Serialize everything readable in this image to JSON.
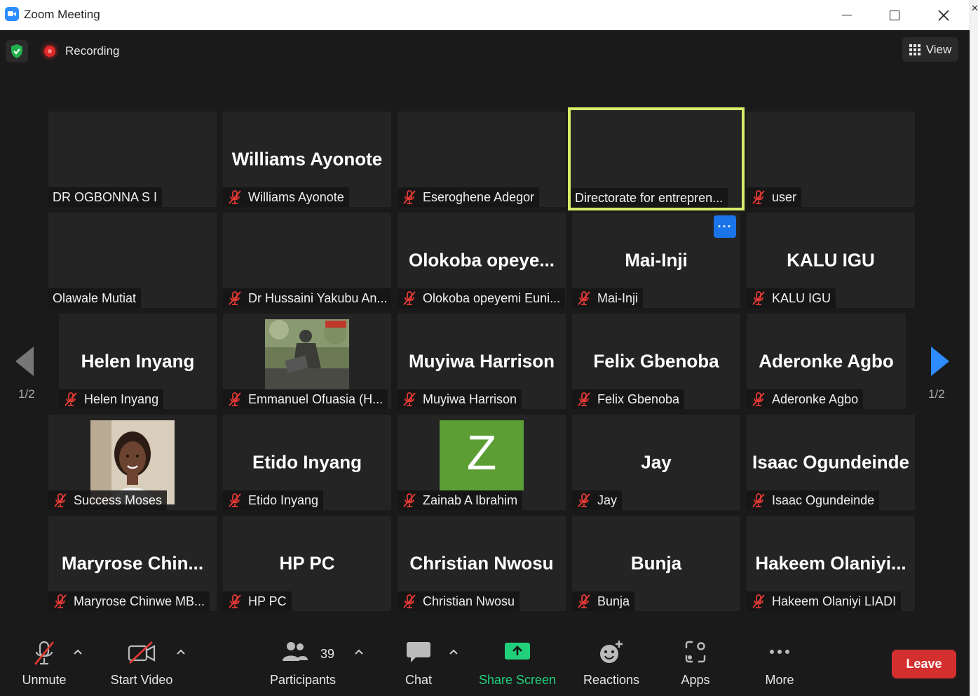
{
  "window": {
    "title": "Zoom Meeting",
    "app_logo": "zoom-camera-icon"
  },
  "topbar": {
    "recording_label": "Recording",
    "view_label": "View"
  },
  "colors": {
    "background": "#1a1a1a",
    "tile": "#242424",
    "active_speaker": "#d7ed6a",
    "accent": "#2d8cff",
    "share_green": "#21d07a",
    "leave_red": "#d32f2f",
    "muted_red": "#e53935"
  },
  "pager": {
    "page_left": "1/2",
    "page_right": "1/2"
  },
  "tiles": [
    {
      "center": "",
      "name": "DR OGBONNA S I",
      "muted": false
    },
    {
      "center": "Williams Ayonote",
      "name": "Williams Ayonote",
      "muted": true
    },
    {
      "center": "",
      "name": "Eseroghene Adegor",
      "muted": true
    },
    {
      "center": "",
      "name": "Directorate for entrepren...",
      "muted": false,
      "active": true
    },
    {
      "center": "",
      "name": "user",
      "muted": true
    },
    {
      "center": "",
      "name": "Olawale Mutiat",
      "muted": false
    },
    {
      "center": "",
      "name": "Dr Hussaini Yakubu An...",
      "muted": true
    },
    {
      "center": "Olokoba  opeye...",
      "name": "Olokoba opeyemi Euni...",
      "muted": true
    },
    {
      "center": "Mai-Inji",
      "name": "Mai-Inji",
      "muted": true,
      "more": "···"
    },
    {
      "center": "KALU IGU",
      "name": "KALU IGU",
      "muted": true
    },
    {
      "center": "Helen Inyang",
      "name": "Helen Inyang",
      "muted": true
    },
    {
      "center": "",
      "name": "Emmanuel Ofuasia (H...",
      "muted": true,
      "photo": "statue-photo"
    },
    {
      "center": "Muyiwa Harrison",
      "name": "Muyiwa Harrison",
      "muted": true
    },
    {
      "center": "Felix Gbenoba",
      "name": "Felix Gbenoba",
      "muted": true
    },
    {
      "center": "Aderonke Agbo",
      "name": "Aderonke Agbo",
      "muted": true
    },
    {
      "center": "",
      "name": "Success Moses",
      "muted": true,
      "photo": "portrait-photo"
    },
    {
      "center": "Etido Inyang",
      "name": "Etido Inyang",
      "muted": true
    },
    {
      "center": "",
      "name": "Zainab A Ibrahim",
      "muted": true,
      "avatar_letter": "Z"
    },
    {
      "center": "Jay",
      "name": "Jay",
      "muted": true
    },
    {
      "center": "Isaac Ogundeinde",
      "name": "Isaac Ogundeinde",
      "muted": true
    },
    {
      "center": "Maryrose  Chin...",
      "name": "Maryrose Chinwe MB...",
      "muted": true
    },
    {
      "center": "HP PC",
      "name": "HP PC",
      "muted": true
    },
    {
      "center": "Christian Nwosu",
      "name": "Christian Nwosu",
      "muted": true
    },
    {
      "center": "Bunja",
      "name": "Bunja",
      "muted": true
    },
    {
      "center": "Hakeem  Olaniyi...",
      "name": "Hakeem Olaniyi LIADI",
      "muted": true
    }
  ],
  "toolbar": {
    "unmute": "Unmute",
    "start_video": "Start Video",
    "participants": "Participants",
    "participants_count": "39",
    "chat": "Chat",
    "share_screen": "Share Screen",
    "reactions": "Reactions",
    "apps": "Apps",
    "more": "More",
    "leave": "Leave"
  }
}
